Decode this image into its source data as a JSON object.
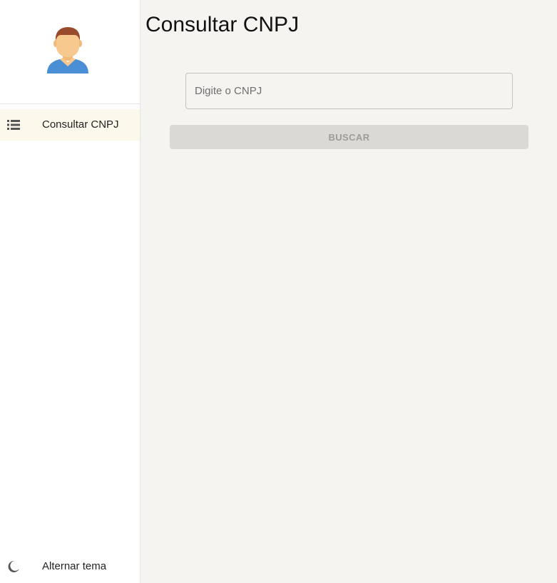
{
  "sidebar": {
    "avatar_icon": "user-avatar",
    "items": [
      {
        "label": "Consultar CNPJ",
        "icon": "list-icon",
        "active": true
      }
    ],
    "theme_toggle": {
      "label": "Alternar tema",
      "icon": "moon-icon"
    }
  },
  "main": {
    "title": "Consultar CNPJ",
    "cnpj_input": {
      "placeholder": "Digite o CNPJ",
      "value": ""
    },
    "search_button": {
      "label": "BUSCAR",
      "disabled": true
    }
  },
  "colors": {
    "background": "#f6f4f0",
    "sidebar": "#ffffff",
    "active_item": "#fdf8ec",
    "button_disabled": "#dad9d5",
    "button_text_disabled": "#9d9c99"
  }
}
